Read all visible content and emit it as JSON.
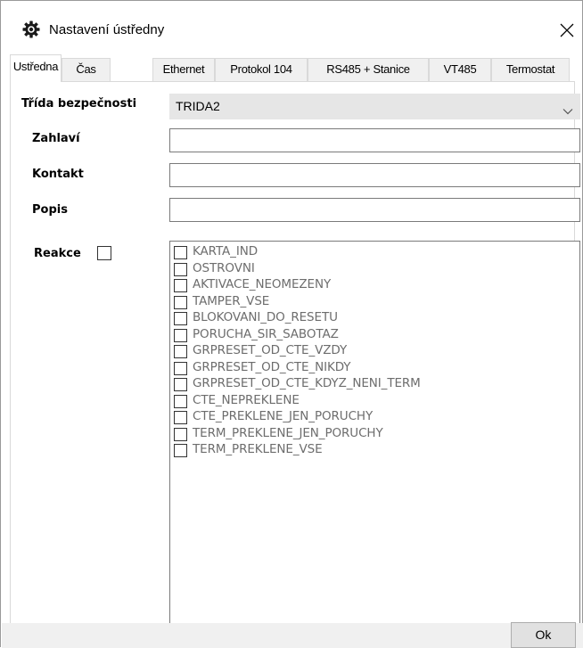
{
  "window": {
    "title": "Nastavení ústředny",
    "icon": "gear-icon",
    "close_icon": "close-icon"
  },
  "tabs": [
    {
      "label": "Ustředna",
      "active": true
    },
    {
      "label": "Čas",
      "active": false
    },
    {
      "label": "Ethernet",
      "active": false
    },
    {
      "label": "Protokol 104",
      "active": false
    },
    {
      "label": "RS485 + Stanice",
      "active": false
    },
    {
      "label": "VT485",
      "active": false
    },
    {
      "label": "Termostat",
      "active": false
    }
  ],
  "form": {
    "trida_label": "Třída bezpečnosti",
    "trida_value": "TRIDA2",
    "zahlavi_label": "Zahlaví",
    "zahlavi_value": "",
    "kontakt_label": "Kontakt",
    "kontakt_value": "",
    "popis_label": "Popis",
    "popis_value": "",
    "reakce_label": "Reakce",
    "reakce_checked": false
  },
  "options": [
    {
      "label": "KARTA_IND",
      "checked": false
    },
    {
      "label": "OSTROVNI",
      "checked": false
    },
    {
      "label": "AKTIVACE_NEOMEZENY",
      "checked": false
    },
    {
      "label": "TAMPER_VSE",
      "checked": false
    },
    {
      "label": "BLOKOVANI_DO_RESETU",
      "checked": false
    },
    {
      "label": "PORUCHA_SIR_SABOTAZ",
      "checked": false
    },
    {
      "label": "GRPRESET_OD_CTE_VZDY",
      "checked": false
    },
    {
      "label": "GRPRESET_OD_CTE_NIKDY",
      "checked": false
    },
    {
      "label": "GRPRESET_OD_CTE_KDYZ_NENI_TERM",
      "checked": false
    },
    {
      "label": "CTE_NEPREKLENE",
      "checked": false
    },
    {
      "label": "CTE_PREKLENE_JEN_PORUCHY",
      "checked": false
    },
    {
      "label": "TERM_PREKLENE_JEN_PORUCHY",
      "checked": false
    },
    {
      "label": "TERM_PREKLENE_VSE",
      "checked": false
    }
  ],
  "buttons": {
    "ok_label": "Ok"
  },
  "colors": {
    "select_bg": "#e6e6e6",
    "option_text": "#6d6d6d",
    "button_bg": "#e1e1e1"
  }
}
